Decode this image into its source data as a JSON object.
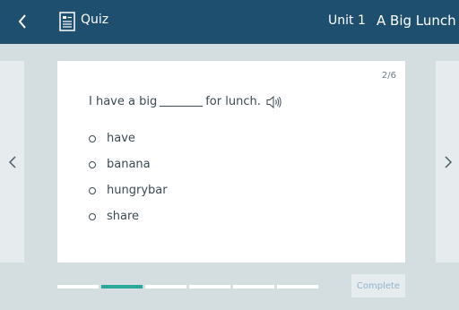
{
  "header": {
    "back_icon": "chevron-left-icon",
    "quiz_icon": "document-icon",
    "quiz_label": "Quiz",
    "unit_label": "Unit 1",
    "lesson_title": "A Big Lunch"
  },
  "card": {
    "page_count": "2/6",
    "question_before": "I have a big",
    "question_after": "for lunch.",
    "speaker_icon": "speaker-icon",
    "options": [
      {
        "label": "have"
      },
      {
        "label": "banana"
      },
      {
        "label": "hungrybar"
      },
      {
        "label": "share"
      }
    ]
  },
  "nav": {
    "prev_icon": "chevron-left-icon",
    "next_icon": "chevron-right-icon"
  },
  "progress": {
    "total": 6,
    "current": 2
  },
  "footer": {
    "complete_label": "Complete"
  },
  "colors": {
    "header_bg": "#1f4f6e",
    "page_bg": "#d4dde0",
    "accent": "#2aa89a",
    "complete_text": "#8fb3cf"
  }
}
